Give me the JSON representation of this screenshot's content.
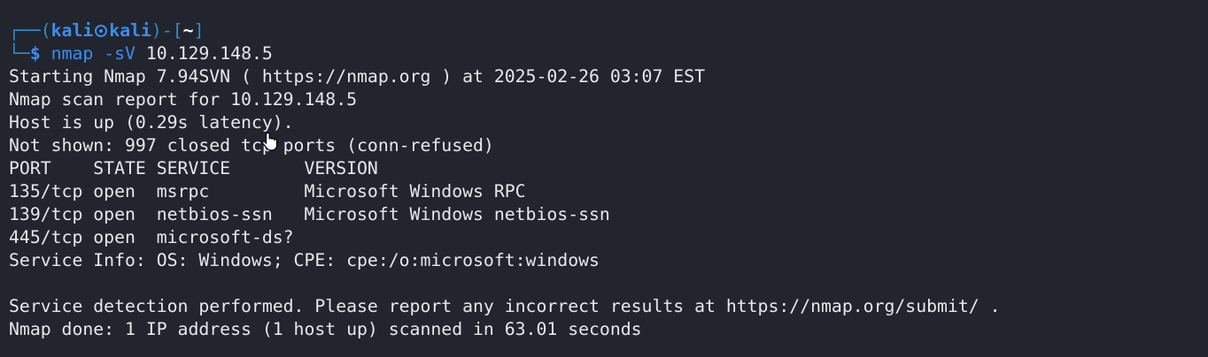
{
  "prompt": {
    "frame_top_left": "┌──(",
    "user": "kali",
    "host": "kali",
    "frame_mid": ")-[",
    "cwd": "~",
    "frame_close": "]",
    "frame_bottom": "└─",
    "symbol": "$",
    "command": "nmap",
    "option": "-sV",
    "argument": "10.129.148.5"
  },
  "output": [
    "Starting Nmap 7.94SVN ( https://nmap.org ) at 2025-02-26 03:07 EST",
    "Nmap scan report for 10.129.148.5",
    "Host is up (0.29s latency).",
    "Not shown: 997 closed tcp ports (conn-refused)",
    "PORT    STATE SERVICE       VERSION",
    "135/tcp open  msrpc         Microsoft Windows RPC",
    "139/tcp open  netbios-ssn   Microsoft Windows netbios-ssn",
    "445/tcp open  microsoft-ds?",
    "Service Info: OS: Windows; CPE: cpe:/o:microsoft:windows",
    "",
    "Service detection performed. Please report any incorrect results at https://nmap.org/submit/ .",
    "Nmap done: 1 IP address (1 host up) scanned in 63.01 seconds"
  ],
  "colors": {
    "background": "#22252d",
    "prompt_accent": "#3b8df0",
    "text": "#e6e8ec"
  },
  "icons": {
    "prompt_separator": "kali-skull-icon",
    "mouse_cursor": "hand-pointer-icon"
  }
}
